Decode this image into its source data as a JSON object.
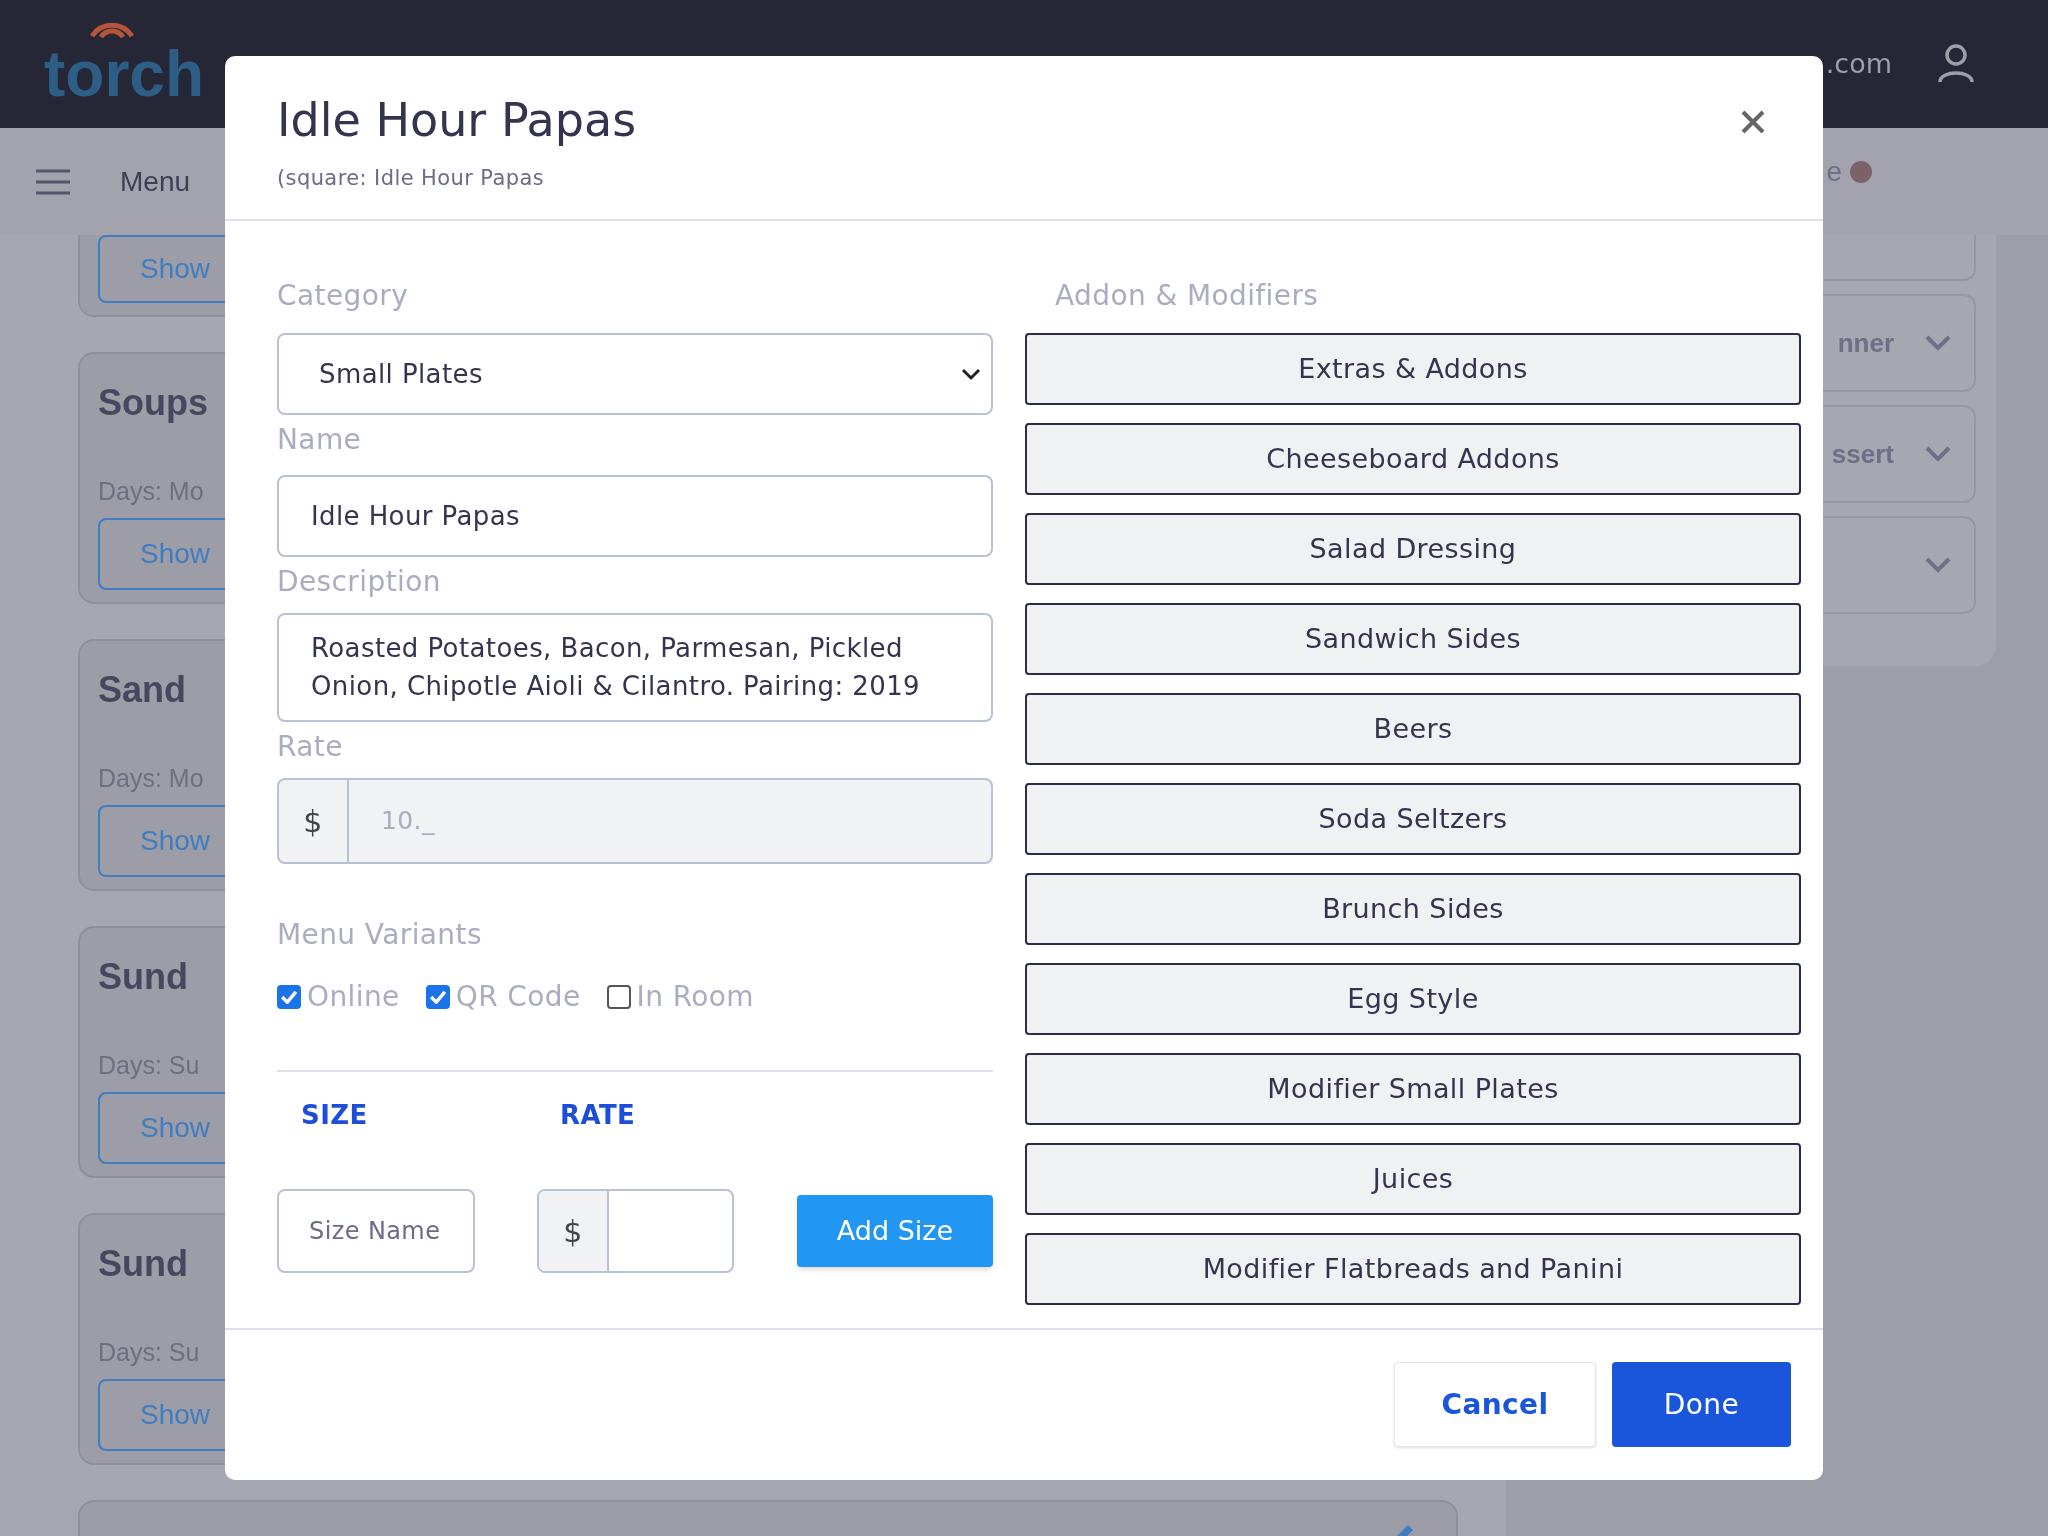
{
  "background": {
    "logo": "torch",
    "header_text": ".com",
    "menu_label": "Menu",
    "status_text": "e",
    "left_cards": [
      {
        "button": "Show"
      },
      {
        "title": "Soups",
        "days": "Days: Mo",
        "button": "Show"
      },
      {
        "title": "Sand",
        "days": "Days: Mo",
        "button": "Show"
      },
      {
        "title": "Sund",
        "days": "Days: Su",
        "button": "Show"
      },
      {
        "title": "Sund",
        "days": "Days: Su",
        "button": "Show"
      }
    ],
    "right_cards": [
      {
        "chevron": false
      },
      {
        "title": "nner",
        "chevron": true
      },
      {
        "title": "ssert",
        "chevron": true
      },
      {
        "chevron": true
      }
    ]
  },
  "modal": {
    "title": "Idle Hour Papas",
    "subtitle": "(square: Idle Hour Papas",
    "category": {
      "label": "Category",
      "value": "Small Plates"
    },
    "name": {
      "label": "Name",
      "value": "Idle Hour Papas"
    },
    "description": {
      "label": "Description",
      "value": "Roasted Potatoes, Bacon, Parmesan, Pickled Onion, Chipotle Aioli & Cilantro. Pairing: 2019"
    },
    "rate": {
      "label": "Rate",
      "prefix": "$",
      "placeholder": "10._"
    },
    "menu_variants": {
      "label": "Menu Variants",
      "options": [
        {
          "label": "Online",
          "checked": true
        },
        {
          "label": "QR Code",
          "checked": true
        },
        {
          "label": "In Room",
          "checked": false
        }
      ]
    },
    "sizes": {
      "columns": [
        "SIZE",
        "RATE"
      ],
      "size_placeholder": "Size Name",
      "prefix": "$",
      "add_button": "Add Size"
    },
    "addons": {
      "label": "Addon & Modifiers",
      "items": [
        "Extras & Addons",
        "Cheeseboard Addons",
        "Salad Dressing",
        "Sandwich Sides",
        "Beers",
        "Soda Seltzers",
        "Brunch Sides",
        "Egg Style",
        "Modifier Small Plates",
        "Juices",
        "Modifier Flatbreads and Panini"
      ]
    },
    "footer": {
      "cancel": "Cancel",
      "done": "Done"
    }
  }
}
